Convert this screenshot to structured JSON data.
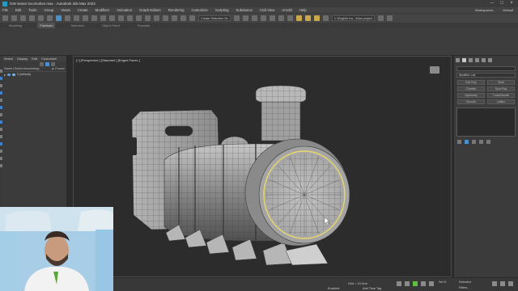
{
  "app": {
    "title": "GW steam locomotive.max - Autodesk 3ds Max 2023",
    "window_controls": [
      "–",
      "□",
      "×"
    ]
  },
  "menu": {
    "items": [
      "File",
      "Edit",
      "Tools",
      "Group",
      "Views",
      "Create",
      "Modifiers",
      "Animation",
      "Graph Editors",
      "Rendering",
      "Customize",
      "Scripting",
      "Substance",
      "Civil View",
      "Arnold",
      "Help"
    ],
    "workspaces_label": "Workspaces:",
    "workspaces_value": "Default"
  },
  "toolbar": {
    "create_selection_set": "Create Selection Se",
    "project": "C:\\English Ins...\\Max project"
  },
  "ribbon": {
    "tabs": [
      "Modeling",
      "Freeform",
      "Selection",
      "Object Paint",
      "Populate"
    ],
    "active_tab": "Freeform"
  },
  "scene_explorer": {
    "tabs": [
      "Select",
      "Display",
      "Edit",
      "Customize"
    ],
    "column_name": "Name (Sorted Ascending)",
    "column_frozen": "▲ Frozen",
    "root_item": "0 (default)"
  },
  "viewport": {
    "label": "[+] [Perspective ] [Standard ] [Edged Faces ]"
  },
  "command_panel": {
    "modifier_list": "Modifier List",
    "modifier_buttons": [
      "Edit Poly",
      "Shell",
      "Chamfer",
      "Sym-Poly",
      "Symmetry",
      "TurboSmooth",
      "Smooth",
      "Lattice"
    ]
  },
  "status_bar": {
    "selected_label": "Selected",
    "enabled_label": "Enabled:",
    "add_time_tag": "Add Time Tag",
    "grid": "Grid = 10.0cm",
    "set_k": "Set K.",
    "filters": "Filters..."
  },
  "colors": {
    "accent": "#4a90c8",
    "viewport_bg": "#2c2c2c",
    "selection_yellow": "#e8d86a"
  }
}
